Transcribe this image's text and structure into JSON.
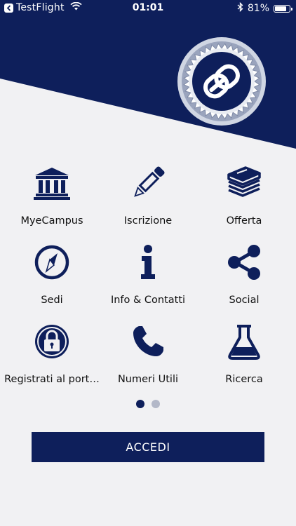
{
  "status_bar": {
    "app_name": "TestFlight",
    "time": "01:01",
    "battery_percent": "81%",
    "battery_level": 0.81
  },
  "colors": {
    "brand_navy": "#0e1f5b",
    "background": "#f1f1f3",
    "dot_inactive": "#b3b8c8"
  },
  "menu": {
    "items": [
      {
        "label": "MyeCampus",
        "icon": "bank-icon"
      },
      {
        "label": "Iscrizione",
        "icon": "pencil-icon"
      },
      {
        "label": "Offerta",
        "icon": "books-icon"
      },
      {
        "label": "Sedi",
        "icon": "compass-icon"
      },
      {
        "label": "Info & Contatti",
        "icon": "info-icon"
      },
      {
        "label": "Social",
        "icon": "share-icon"
      },
      {
        "label": "Registrati al port…",
        "icon": "lock-icon"
      },
      {
        "label": "Numeri Utili",
        "icon": "phone-icon"
      },
      {
        "label": "Ricerca",
        "icon": "flask-icon"
      }
    ]
  },
  "pagination": {
    "pages": 2,
    "active": 1
  },
  "login_button": "ACCEDI"
}
